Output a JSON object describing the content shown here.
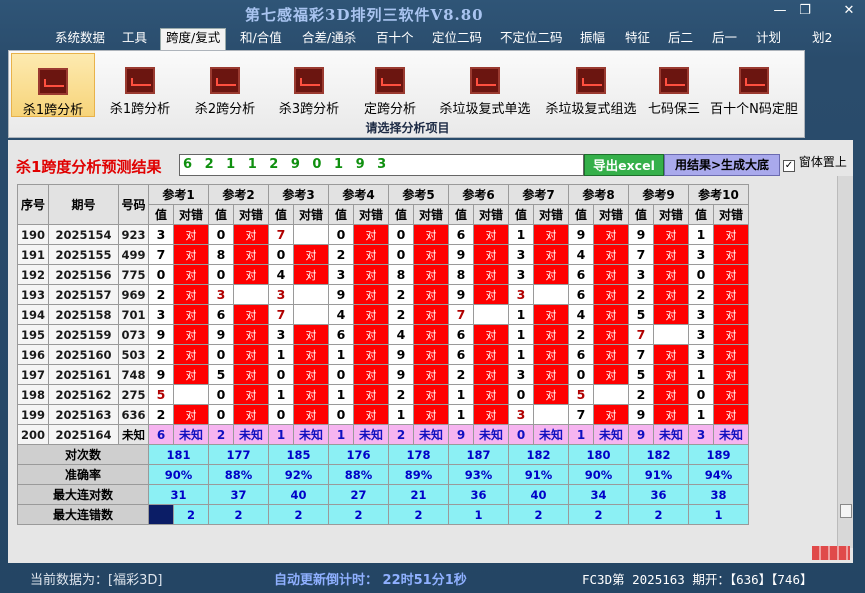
{
  "window": {
    "title": "第七感福彩3D排列三软件V8.80",
    "minimize": "—",
    "restore": "❐",
    "close": "✕"
  },
  "menu": [
    "系统数据",
    "工具",
    "跨度/复式",
    "和/合值",
    "合差/通杀",
    "百十个",
    "定位二码",
    "不定位二码",
    "振幅",
    "特征",
    "后二",
    "后一",
    "计划",
    "划2"
  ],
  "menu_active": 2,
  "toolbar": {
    "items": [
      "杀1跨分析",
      "杀1跨分析",
      "杀2跨分析",
      "杀3跨分析",
      "定跨分析",
      "杀垃圾复式单选",
      "杀垃圾复式组选",
      "七码保三",
      "百十个N码定胆"
    ],
    "selected": 0,
    "caption": "请选择分析项目"
  },
  "result": {
    "label": "杀1跨度分析预测结果",
    "value": "6 2 1 1 2 9 0 1 9 3",
    "export_button": "导出excel",
    "generate_button": "用结果>生成大底",
    "ontop_label": "窗体置上",
    "ontop_checked": true
  },
  "table": {
    "headers": {
      "seq": "序号",
      "period": "期号",
      "code": "号码",
      "value": "值",
      "result": "对错"
    },
    "refs": [
      "参考1",
      "参考2",
      "参考3",
      "参考4",
      "参考5",
      "参考6",
      "参考7",
      "参考8",
      "参考9",
      "参考10"
    ],
    "correct_mark": "对",
    "rows": [
      {
        "seq": "190",
        "period": "2025154",
        "code": "923",
        "refs": [
          [
            "3",
            1
          ],
          [
            "0",
            1
          ],
          [
            "7",
            0
          ],
          [
            "0",
            1
          ],
          [
            "0",
            1
          ],
          [
            "6",
            1
          ],
          [
            "1",
            1
          ],
          [
            "9",
            1
          ],
          [
            "9",
            1
          ],
          [
            "1",
            1
          ]
        ]
      },
      {
        "seq": "191",
        "period": "2025155",
        "code": "499",
        "refs": [
          [
            "7",
            1
          ],
          [
            "8",
            1
          ],
          [
            "0",
            1
          ],
          [
            "2",
            1
          ],
          [
            "0",
            1
          ],
          [
            "9",
            1
          ],
          [
            "3",
            1
          ],
          [
            "4",
            1
          ],
          [
            "7",
            1
          ],
          [
            "3",
            1
          ]
        ]
      },
      {
        "seq": "192",
        "period": "2025156",
        "code": "775",
        "refs": [
          [
            "0",
            1
          ],
          [
            "0",
            1
          ],
          [
            "4",
            1
          ],
          [
            "3",
            1
          ],
          [
            "8",
            1
          ],
          [
            "8",
            1
          ],
          [
            "3",
            1
          ],
          [
            "6",
            1
          ],
          [
            "3",
            1
          ],
          [
            "0",
            1
          ]
        ]
      },
      {
        "seq": "193",
        "period": "2025157",
        "code": "969",
        "refs": [
          [
            "2",
            1
          ],
          [
            "3",
            0
          ],
          [
            "3",
            0
          ],
          [
            "9",
            1
          ],
          [
            "2",
            1
          ],
          [
            "9",
            1
          ],
          [
            "3",
            0
          ],
          [
            "6",
            1
          ],
          [
            "2",
            1
          ],
          [
            "2",
            1
          ]
        ]
      },
      {
        "seq": "194",
        "period": "2025158",
        "code": "701",
        "refs": [
          [
            "3",
            1
          ],
          [
            "6",
            1
          ],
          [
            "7",
            0
          ],
          [
            "4",
            1
          ],
          [
            "2",
            1
          ],
          [
            "7",
            0
          ],
          [
            "1",
            1
          ],
          [
            "4",
            1
          ],
          [
            "5",
            1
          ],
          [
            "3",
            1
          ]
        ]
      },
      {
        "seq": "195",
        "period": "2025159",
        "code": "073",
        "refs": [
          [
            "9",
            1
          ],
          [
            "9",
            1
          ],
          [
            "3",
            1
          ],
          [
            "6",
            1
          ],
          [
            "4",
            1
          ],
          [
            "6",
            1
          ],
          [
            "1",
            1
          ],
          [
            "2",
            1
          ],
          [
            "7",
            0
          ],
          [
            "3",
            1
          ]
        ]
      },
      {
        "seq": "196",
        "period": "2025160",
        "code": "503",
        "refs": [
          [
            "2",
            1
          ],
          [
            "0",
            1
          ],
          [
            "1",
            1
          ],
          [
            "1",
            1
          ],
          [
            "9",
            1
          ],
          [
            "6",
            1
          ],
          [
            "1",
            1
          ],
          [
            "6",
            1
          ],
          [
            "7",
            1
          ],
          [
            "3",
            1
          ]
        ]
      },
      {
        "seq": "197",
        "period": "2025161",
        "code": "748",
        "refs": [
          [
            "9",
            1
          ],
          [
            "5",
            1
          ],
          [
            "0",
            1
          ],
          [
            "0",
            1
          ],
          [
            "9",
            1
          ],
          [
            "2",
            1
          ],
          [
            "3",
            1
          ],
          [
            "0",
            1
          ],
          [
            "5",
            1
          ],
          [
            "1",
            1
          ]
        ]
      },
      {
        "seq": "198",
        "period": "2025162",
        "code": "275",
        "refs": [
          [
            "5",
            0
          ],
          [
            "0",
            1
          ],
          [
            "1",
            1
          ],
          [
            "1",
            1
          ],
          [
            "2",
            1
          ],
          [
            "1",
            1
          ],
          [
            "0",
            1
          ],
          [
            "5",
            0
          ],
          [
            "2",
            1
          ],
          [
            "0",
            1
          ]
        ]
      },
      {
        "seq": "199",
        "period": "2025163",
        "code": "636",
        "refs": [
          [
            "2",
            1
          ],
          [
            "0",
            1
          ],
          [
            "0",
            1
          ],
          [
            "0",
            1
          ],
          [
            "1",
            1
          ],
          [
            "1",
            1
          ],
          [
            "3",
            0
          ],
          [
            "7",
            1
          ],
          [
            "9",
            1
          ],
          [
            "1",
            1
          ]
        ]
      }
    ],
    "pending": {
      "seq": "200",
      "period": "2025164",
      "code": "未知",
      "values": [
        "6",
        "2",
        "1",
        "1",
        "2",
        "9",
        "0",
        "1",
        "9",
        "3"
      ],
      "status": "未知"
    },
    "stats": {
      "labels": [
        "对次数",
        "准确率",
        "最大连对数",
        "最大连错数"
      ],
      "hits": [
        "181",
        "177",
        "185",
        "176",
        "178",
        "187",
        "182",
        "180",
        "182",
        "189"
      ],
      "accuracy": [
        "90%",
        "88%",
        "92%",
        "88%",
        "89%",
        "93%",
        "91%",
        "90%",
        "91%",
        "94%"
      ],
      "max_streak_ok": [
        "31",
        "37",
        "40",
        "27",
        "21",
        "36",
        "40",
        "34",
        "36",
        "38"
      ],
      "max_streak_err": [
        "2",
        "2",
        "2",
        "2",
        "2",
        "1",
        "2",
        "2",
        "2",
        "1"
      ]
    }
  },
  "status": {
    "data_label": "当前数据为：[福彩3D]",
    "countdown": "自动更新倒计时：  22时51分1秒",
    "draw": "FC3D第 2025163 期开：【636】【746】"
  },
  "colors": {
    "correct": "#ff0000",
    "pending": "#f6b4f0",
    "stats": "#8cf0f4",
    "export": "#35b04a",
    "generate": "#a9a9ec",
    "title": "#a9c4f0"
  }
}
